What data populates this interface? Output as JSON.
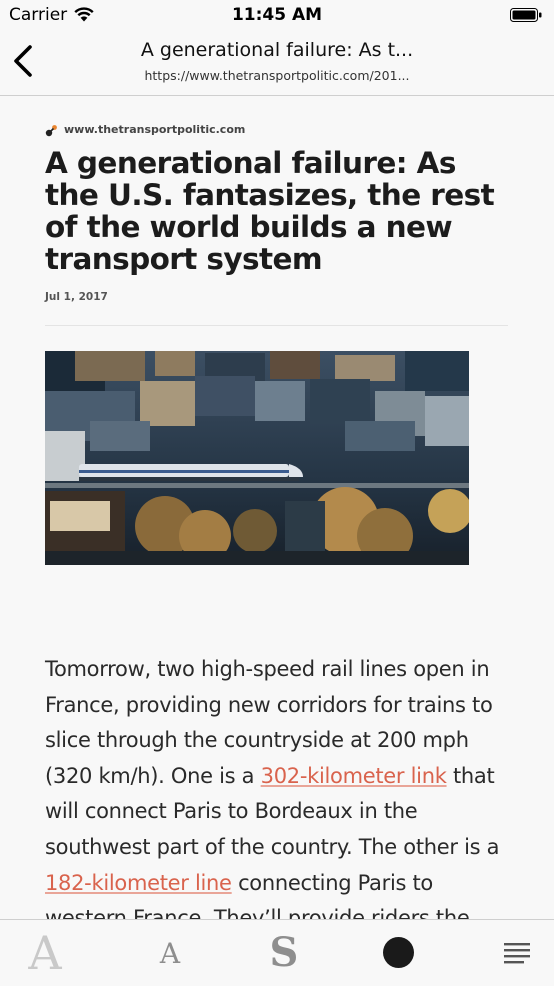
{
  "status_bar": {
    "carrier": "Carrier",
    "time": "11:45 AM"
  },
  "nav": {
    "title": "A generational failure: As t...",
    "url": "https://www.thetransportpolitic.com/201..."
  },
  "article": {
    "source_domain": "www.thetransportpolitic.com",
    "headline": "A generational failure: As the U.S. fantasizes, the rest of the world builds a new transport system",
    "date": "Jul 1, 2017",
    "body": {
      "t1": "Tomorrow, two high-speed rail lines open in France, providing new corridors for trains to slice through the countryside at 200 mph (320 km/h). One is a ",
      "link1": "302-kilometer link",
      "t2": " that will connect Paris to Bordeaux in the southwest part of the country. The other is a ",
      "link2": "182-kilometer line",
      "t3": " connecting Paris to western France. They’ll provide riders the"
    }
  },
  "toolbar": {
    "font_large_glyph": "A",
    "font_small_glyph": "A",
    "font_serif_glyph": "S"
  },
  "icons": {
    "back": "chevron-left-icon",
    "wifi": "wifi-icon",
    "battery": "battery-icon",
    "source": "favicon-icon",
    "theme": "dark-theme-icon",
    "toc": "menu-lines-icon"
  },
  "colors": {
    "link": "#d9634d",
    "background": "#f8f8f8",
    "headline": "#1c1c1c"
  }
}
